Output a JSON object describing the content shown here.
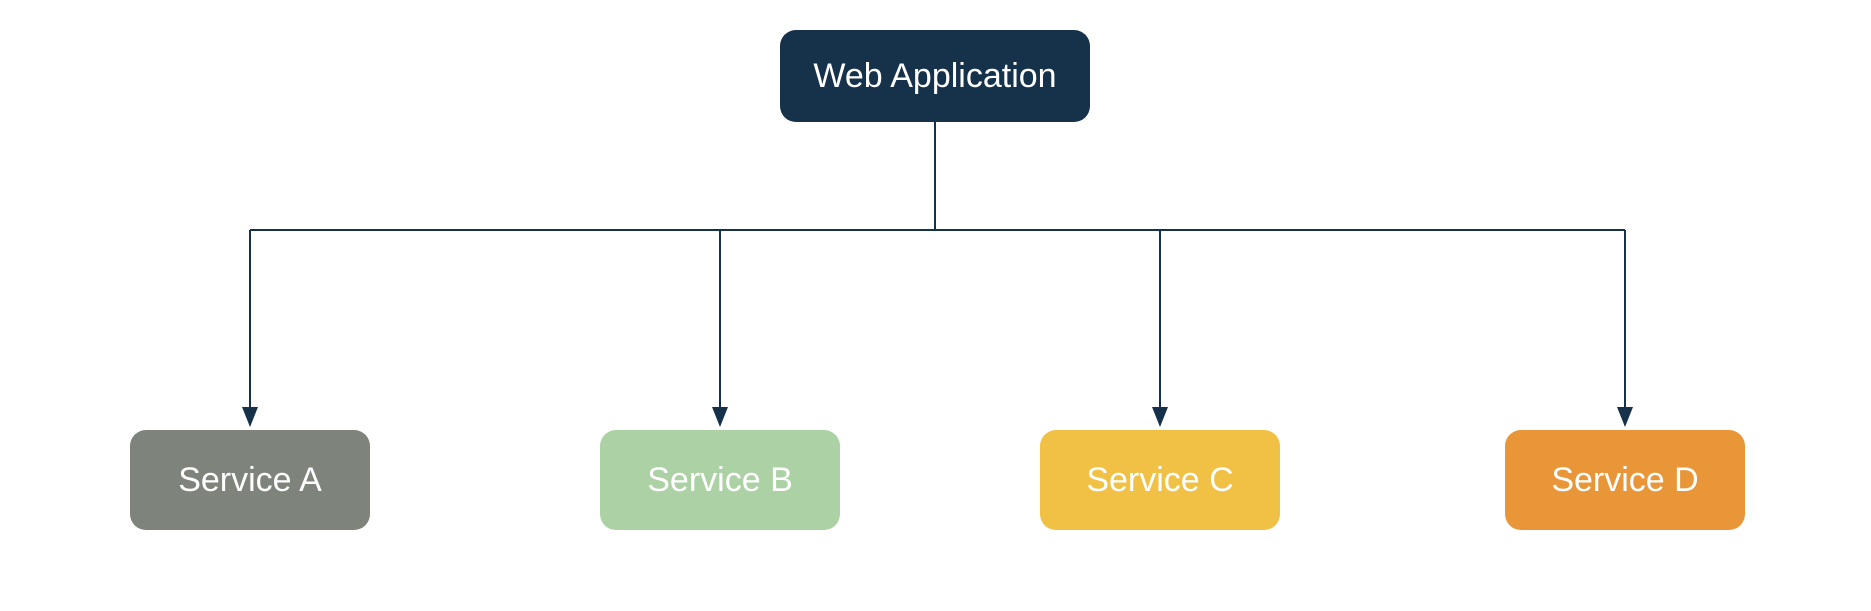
{
  "diagram": {
    "root": {
      "label": "Web Application"
    },
    "services": [
      {
        "id": "a",
        "label": "Service A",
        "color": "#7e847b"
      },
      {
        "id": "b",
        "label": "Service B",
        "color": "#abd1a4"
      },
      {
        "id": "c",
        "label": "Service C",
        "color": "#f1c145"
      },
      {
        "id": "d",
        "label": "Service D",
        "color": "#e89638"
      }
    ],
    "lineColor": "#16324a"
  }
}
